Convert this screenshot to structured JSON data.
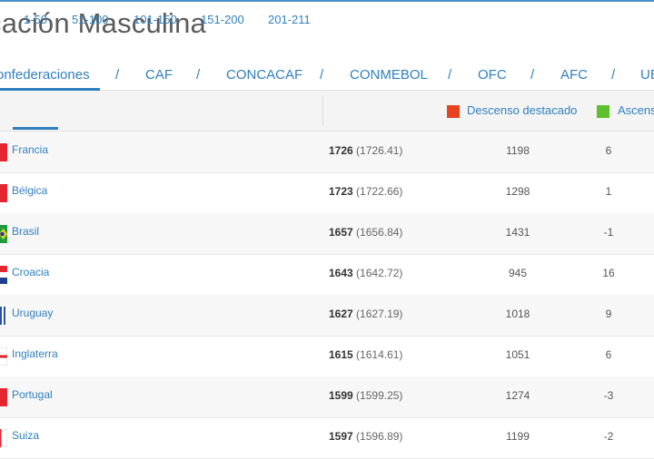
{
  "page": {
    "title": "cación Masculina"
  },
  "confederations": {
    "items": [
      {
        "label": "onfederaciones"
      },
      {
        "label": "CAF"
      },
      {
        "label": "CONCACAF"
      },
      {
        "label": "CONMEBOL"
      },
      {
        "label": "OFC"
      },
      {
        "label": "AFC"
      },
      {
        "label": "UE"
      }
    ],
    "separator": "/"
  },
  "range_tabs": [
    "1-50",
    "51-100",
    "101-150",
    "151-200",
    "201-211"
  ],
  "legend": {
    "down_label": "Descenso destacado",
    "up_label": "Ascens",
    "down_color": "#e8431e",
    "up_color": "#5cc12a"
  },
  "rows": [
    {
      "team": "Francia",
      "points": "1726",
      "exact": "(1726.41)",
      "prev": "1198",
      "change": "6"
    },
    {
      "team": "Bélgica",
      "points": "1723",
      "exact": "(1722.66)",
      "prev": "1298",
      "change": "1"
    },
    {
      "team": "Brasil",
      "points": "1657",
      "exact": "(1656.84)",
      "prev": "1431",
      "change": "-1"
    },
    {
      "team": "Croacia",
      "points": "1643",
      "exact": "(1642.72)",
      "prev": "945",
      "change": "16"
    },
    {
      "team": "Uruguay",
      "points": "1627",
      "exact": "(1627.19)",
      "prev": "1018",
      "change": "9"
    },
    {
      "team": "Inglaterra",
      "points": "1615",
      "exact": "(1614.61)",
      "prev": "1051",
      "change": "6"
    },
    {
      "team": "Portugal",
      "points": "1599",
      "exact": "(1599.25)",
      "prev": "1274",
      "change": "-3"
    },
    {
      "team": "Suiza",
      "points": "1597",
      "exact": "(1596.89)",
      "prev": "1199",
      "change": "-2"
    }
  ]
}
